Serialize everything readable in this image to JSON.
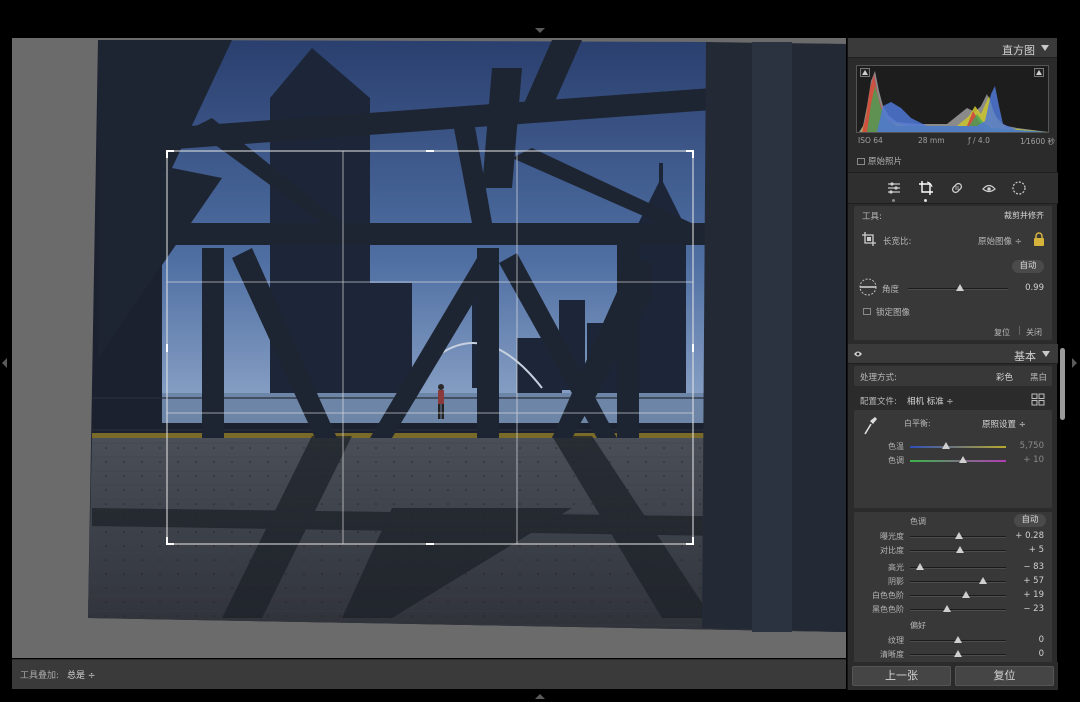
{
  "toolbar": {
    "label": "工具叠加:",
    "value": "总是 ÷"
  },
  "histogram": {
    "title": "直方图",
    "iso": "ISO 64",
    "focal": "28 mm",
    "aperture": "ƒ / 4.0",
    "shutter": "1⁄1600 秒",
    "original_photo": "原始照片"
  },
  "crop": {
    "tool_label": "工具:",
    "tool_name": "裁剪并修齐",
    "aspect_label": "长宽比:",
    "aspect_value": "原始图像 ÷",
    "auto": "自动",
    "angle_label": "角度",
    "angle_value": "0.99",
    "angle_fraction": 0.52,
    "constrain_label": "锁定图像",
    "reset": "复位",
    "close": "关闭"
  },
  "basic": {
    "title": "基本",
    "treatment_label": "处理方式:",
    "treatment_color": "彩色",
    "treatment_bw": "黑白",
    "profile_label": "配置文件:",
    "profile_value": "相机 标准 ÷",
    "wb_label": "白平衡:",
    "wb_value": "原照设置 ÷",
    "temp_label": "色温",
    "temp_value": "5,750",
    "temp_fraction": 0.38,
    "tint_label": "色调",
    "tint_value": "+ 10",
    "tint_fraction": 0.55,
    "tone_label": "色调",
    "tone_auto": "自动",
    "tone_rows": [
      {
        "label": "曝光度",
        "value": "+ 0.28",
        "fraction": 0.51
      },
      {
        "label": "对比度",
        "value": "+ 5",
        "fraction": 0.52
      }
    ],
    "tone_rows2": [
      {
        "label": "高光",
        "value": "− 83",
        "fraction": 0.1
      },
      {
        "label": "阴影",
        "value": "+ 57",
        "fraction": 0.76
      },
      {
        "label": "白色色阶",
        "value": "+ 19",
        "fraction": 0.58
      },
      {
        "label": "黑色色阶",
        "value": "− 23",
        "fraction": 0.39
      }
    ],
    "presence_label": "偏好",
    "presence_rows": [
      {
        "label": "纹理",
        "value": "0",
        "fraction": 0.5
      },
      {
        "label": "清晰度",
        "value": "0",
        "fraction": 0.5
      },
      {
        "label": "去朦胧",
        "value": "0",
        "fraction": 0.5
      }
    ]
  },
  "buttons": {
    "previous": "上一张",
    "reset": "复位"
  }
}
